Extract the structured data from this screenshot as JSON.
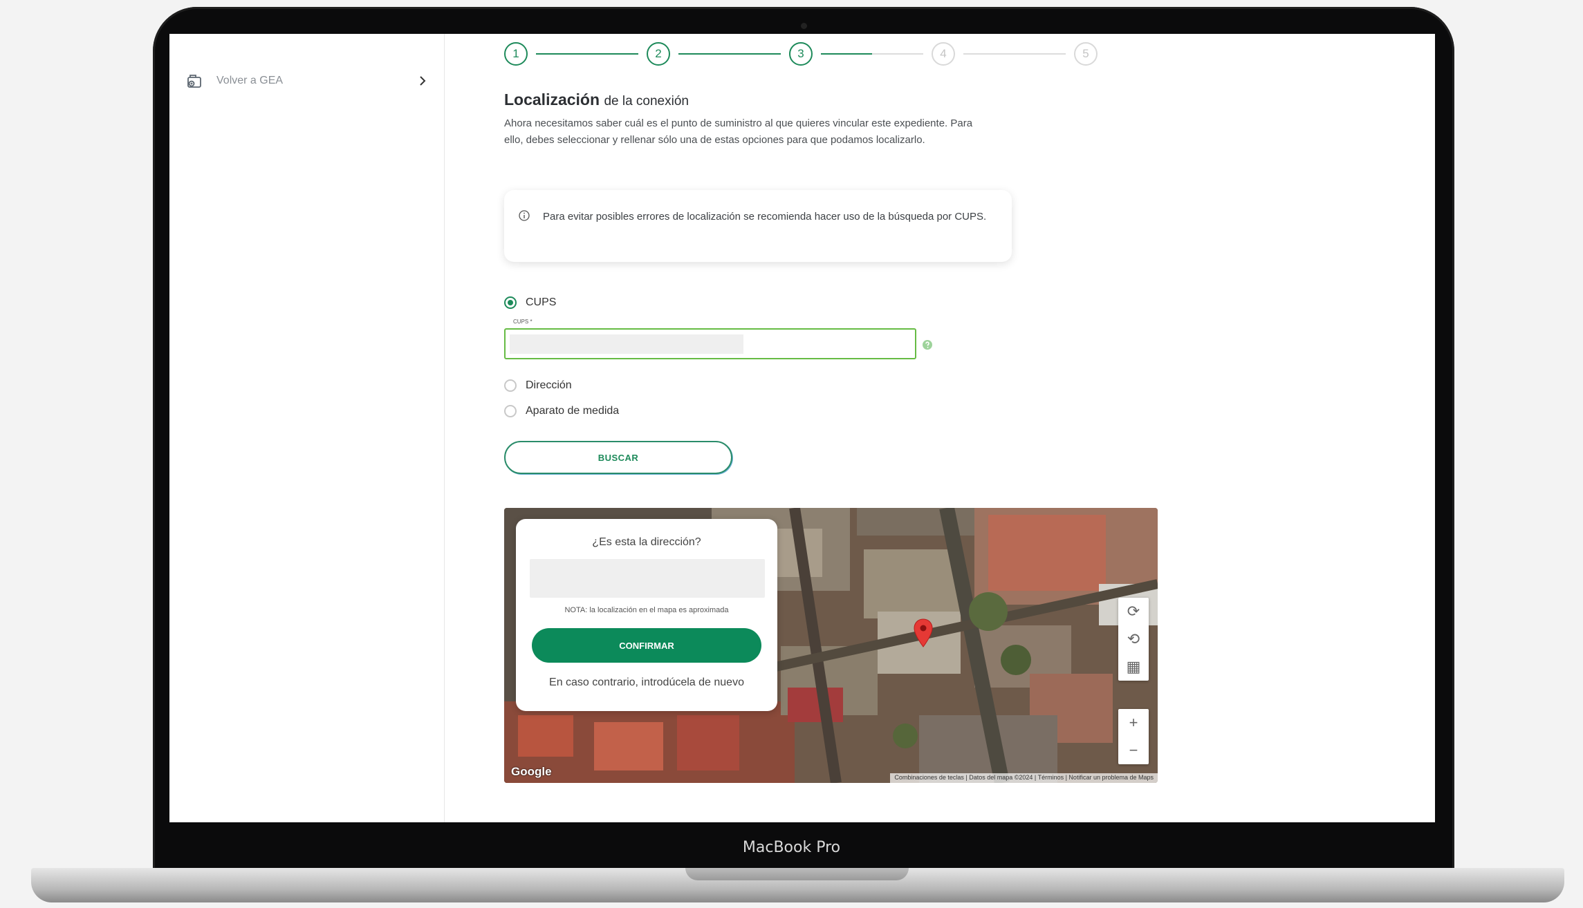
{
  "device": {
    "model": "MacBook Pro"
  },
  "sidebar": {
    "back_label": "Volver a GEA"
  },
  "stepper": {
    "steps": [
      "1",
      "2",
      "3",
      "4",
      "5"
    ],
    "current_step": 3
  },
  "section": {
    "title": "Localización",
    "title_suffix": "de la conexión",
    "description": "Ahora necesitamos saber cuál es el punto de suministro al que quieres vincular este expediente. Para ello, debes seleccionar y rellenar sólo una de estas opciones para que podamos localizarlo."
  },
  "info": {
    "text": "Para evitar posibles errores de localización se recomienda hacer uso de la búsqueda por CUPS."
  },
  "options": {
    "cups": {
      "label": "CUPS",
      "selected": true
    },
    "cups_field": {
      "legend": "CUPS *",
      "value": ""
    },
    "direccion": {
      "label": "Dirección",
      "selected": false
    },
    "aparato": {
      "label": "Aparato de medida",
      "selected": false
    }
  },
  "buttons": {
    "search": "BUSCAR"
  },
  "map": {
    "confirm": {
      "question": "¿Es esta la dirección?",
      "address": "",
      "note": "NOTA: la localización en el mapa es aproximada",
      "confirm_label": "CONFIRMAR",
      "retry_text": "En caso contrario, introdúcela de nuevo"
    },
    "controls": {
      "zoom_in": "+",
      "zoom_out": "−"
    },
    "logo": "Google",
    "footer": "Combinaciones de teclas  |  Datos del mapa ©2024  |  Términos  |  Notificar un problema de Maps"
  },
  "colors": {
    "brand_green": "#1d8a5a",
    "confirm_green": "#0c8a5a",
    "field_border": "#66bb44"
  }
}
